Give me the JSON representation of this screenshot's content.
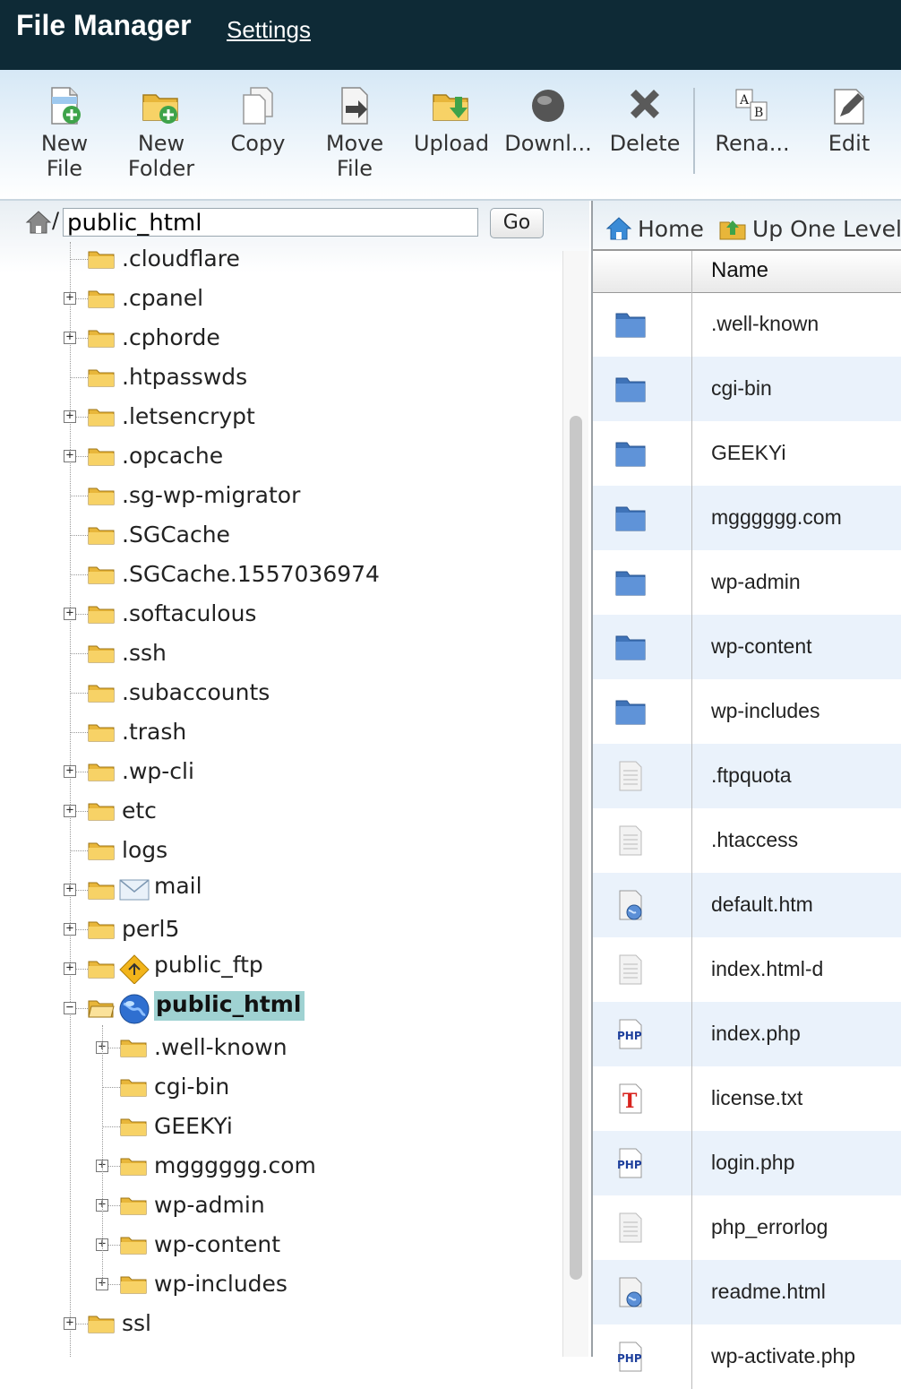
{
  "header": {
    "title": "File Manager",
    "settings_label": "Settings"
  },
  "toolbar": {
    "new_file": [
      "New",
      "File"
    ],
    "new_folder": [
      "New",
      "Folder"
    ],
    "copy": "Copy",
    "move_file": [
      "Move",
      "File"
    ],
    "upload": "Upload",
    "download": "Downl...",
    "delete": "Delete",
    "rename": "Rena...",
    "edit": "Edit"
  },
  "path": {
    "slash": "/",
    "value": "public_html",
    "go_label": "Go"
  },
  "tree": [
    {
      "label": ".cloudflare",
      "expandable": false
    },
    {
      "label": ".cpanel",
      "expandable": true
    },
    {
      "label": ".cphorde",
      "expandable": true
    },
    {
      "label": ".htpasswds",
      "expandable": false
    },
    {
      "label": ".letsencrypt",
      "expandable": true
    },
    {
      "label": ".opcache",
      "expandable": true
    },
    {
      "label": ".sg-wp-migrator",
      "expandable": false
    },
    {
      "label": ".SGCache",
      "expandable": false
    },
    {
      "label": ".SGCache.1557036974",
      "expandable": false
    },
    {
      "label": ".softaculous",
      "expandable": true
    },
    {
      "label": ".ssh",
      "expandable": false
    },
    {
      "label": ".subaccounts",
      "expandable": false
    },
    {
      "label": ".trash",
      "expandable": false
    },
    {
      "label": ".wp-cli",
      "expandable": true
    },
    {
      "label": "etc",
      "expandable": true
    },
    {
      "label": "logs",
      "expandable": false
    },
    {
      "label": "mail",
      "expandable": true,
      "special": "mail"
    },
    {
      "label": "perl5",
      "expandable": true
    },
    {
      "label": "public_ftp",
      "expandable": true,
      "special": "ftp"
    },
    {
      "label": "public_html",
      "expandable": true,
      "expanded": true,
      "special": "globe",
      "selected": true
    },
    {
      "label": ".well-known",
      "expandable": true,
      "child": true
    },
    {
      "label": "cgi-bin",
      "expandable": false,
      "child": true
    },
    {
      "label": "GEEKYi",
      "expandable": false,
      "child": true
    },
    {
      "label": "mgggggg.com",
      "expandable": true,
      "child": true
    },
    {
      "label": "wp-admin",
      "expandable": true,
      "child": true
    },
    {
      "label": "wp-content",
      "expandable": true,
      "child": true
    },
    {
      "label": "wp-includes",
      "expandable": true,
      "child": true
    },
    {
      "label": "ssl",
      "expandable": true
    }
  ],
  "nav": {
    "home_label": "Home",
    "up_label": "Up One Level"
  },
  "table": {
    "header_name": "Name",
    "rows": [
      {
        "name": ".well-known",
        "type": "folder"
      },
      {
        "name": "cgi-bin",
        "type": "folder"
      },
      {
        "name": "GEEKYi",
        "type": "folder"
      },
      {
        "name": "mgggggg.com",
        "type": "folder"
      },
      {
        "name": "wp-admin",
        "type": "folder"
      },
      {
        "name": "wp-content",
        "type": "folder"
      },
      {
        "name": "wp-includes",
        "type": "folder"
      },
      {
        "name": ".ftpquota",
        "type": "file"
      },
      {
        "name": ".htaccess",
        "type": "file"
      },
      {
        "name": "default.htm",
        "type": "html"
      },
      {
        "name": "index.html-d",
        "type": "file"
      },
      {
        "name": "index.php",
        "type": "php"
      },
      {
        "name": "license.txt",
        "type": "text"
      },
      {
        "name": "login.php",
        "type": "php"
      },
      {
        "name": "php_errorlog",
        "type": "file"
      },
      {
        "name": "readme.html",
        "type": "html"
      },
      {
        "name": "wp-activate.php",
        "type": "php"
      }
    ]
  },
  "colors": {
    "topbar": "#0e2a36",
    "selected": "#9fd2d2",
    "row_alt": "#eaf2fb",
    "folder": "#f2c14e"
  }
}
